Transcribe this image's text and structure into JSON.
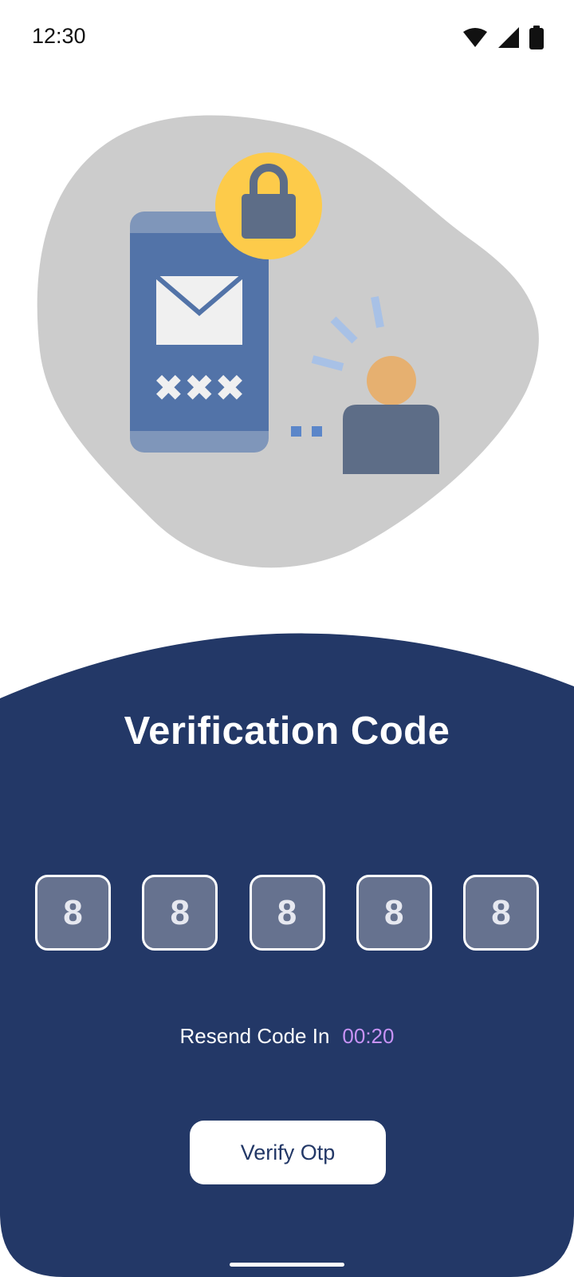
{
  "status_bar": {
    "time": "12:30",
    "icons": [
      "wifi-icon",
      "signal-icon",
      "battery-icon"
    ]
  },
  "illustration": {
    "description_icons": [
      "phone-icon",
      "envelope-icon",
      "lock-icon",
      "user-icon"
    ],
    "masked_code": "✖✖✖"
  },
  "screen": {
    "title": "Verification Code",
    "otp_digits": [
      "8",
      "8",
      "8",
      "8",
      "8"
    ],
    "resend_label": "Resend Code In",
    "resend_timer": "00:20",
    "verify_button": "Verify Otp"
  },
  "colors": {
    "panel": "#233867",
    "otp_box": "#66728f",
    "timer": "#c792f5",
    "blob": "#cccccc",
    "phone": "#5273a8",
    "lock_bg": "#fdcb4a",
    "person_body": "#5d6d87",
    "person_head": "#e6b070"
  }
}
